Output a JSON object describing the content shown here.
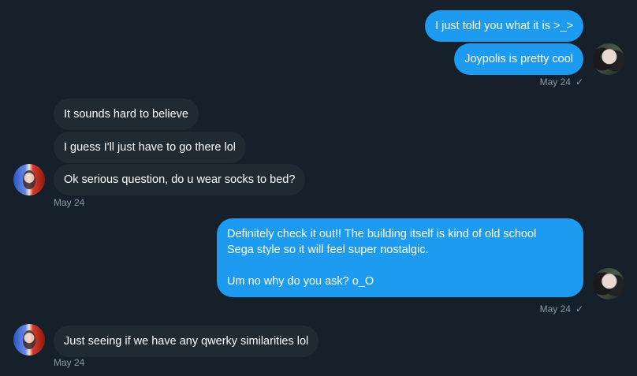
{
  "messages": [
    {
      "text": "I just told you what it is >_>"
    },
    {
      "text": "Joypolis is pretty cool"
    },
    {
      "text": "It sounds hard to believe"
    },
    {
      "text": "I guess I'll just have to go there lol"
    },
    {
      "text": "Ok serious question, do u wear socks to bed?"
    },
    {
      "line1": "Definitely check it out!! The building itself is kind of old school",
      "line2": "Sega style so it will feel super nostalgic.",
      "line3": "Um no why do you ask? o_O"
    },
    {
      "text": "Just seeing if we have any qwerky  similarities lol"
    }
  ],
  "timestamps": {
    "out1": "May 24",
    "in1": "May 24",
    "out2": "May 24",
    "in2": "May 24"
  },
  "icons": {
    "sent_check": "✓"
  },
  "colors": {
    "background": "#15202b",
    "outgoing_bubble": "#1d9bf0",
    "incoming_bubble": "#202a33",
    "meta_text": "#8899a6"
  }
}
